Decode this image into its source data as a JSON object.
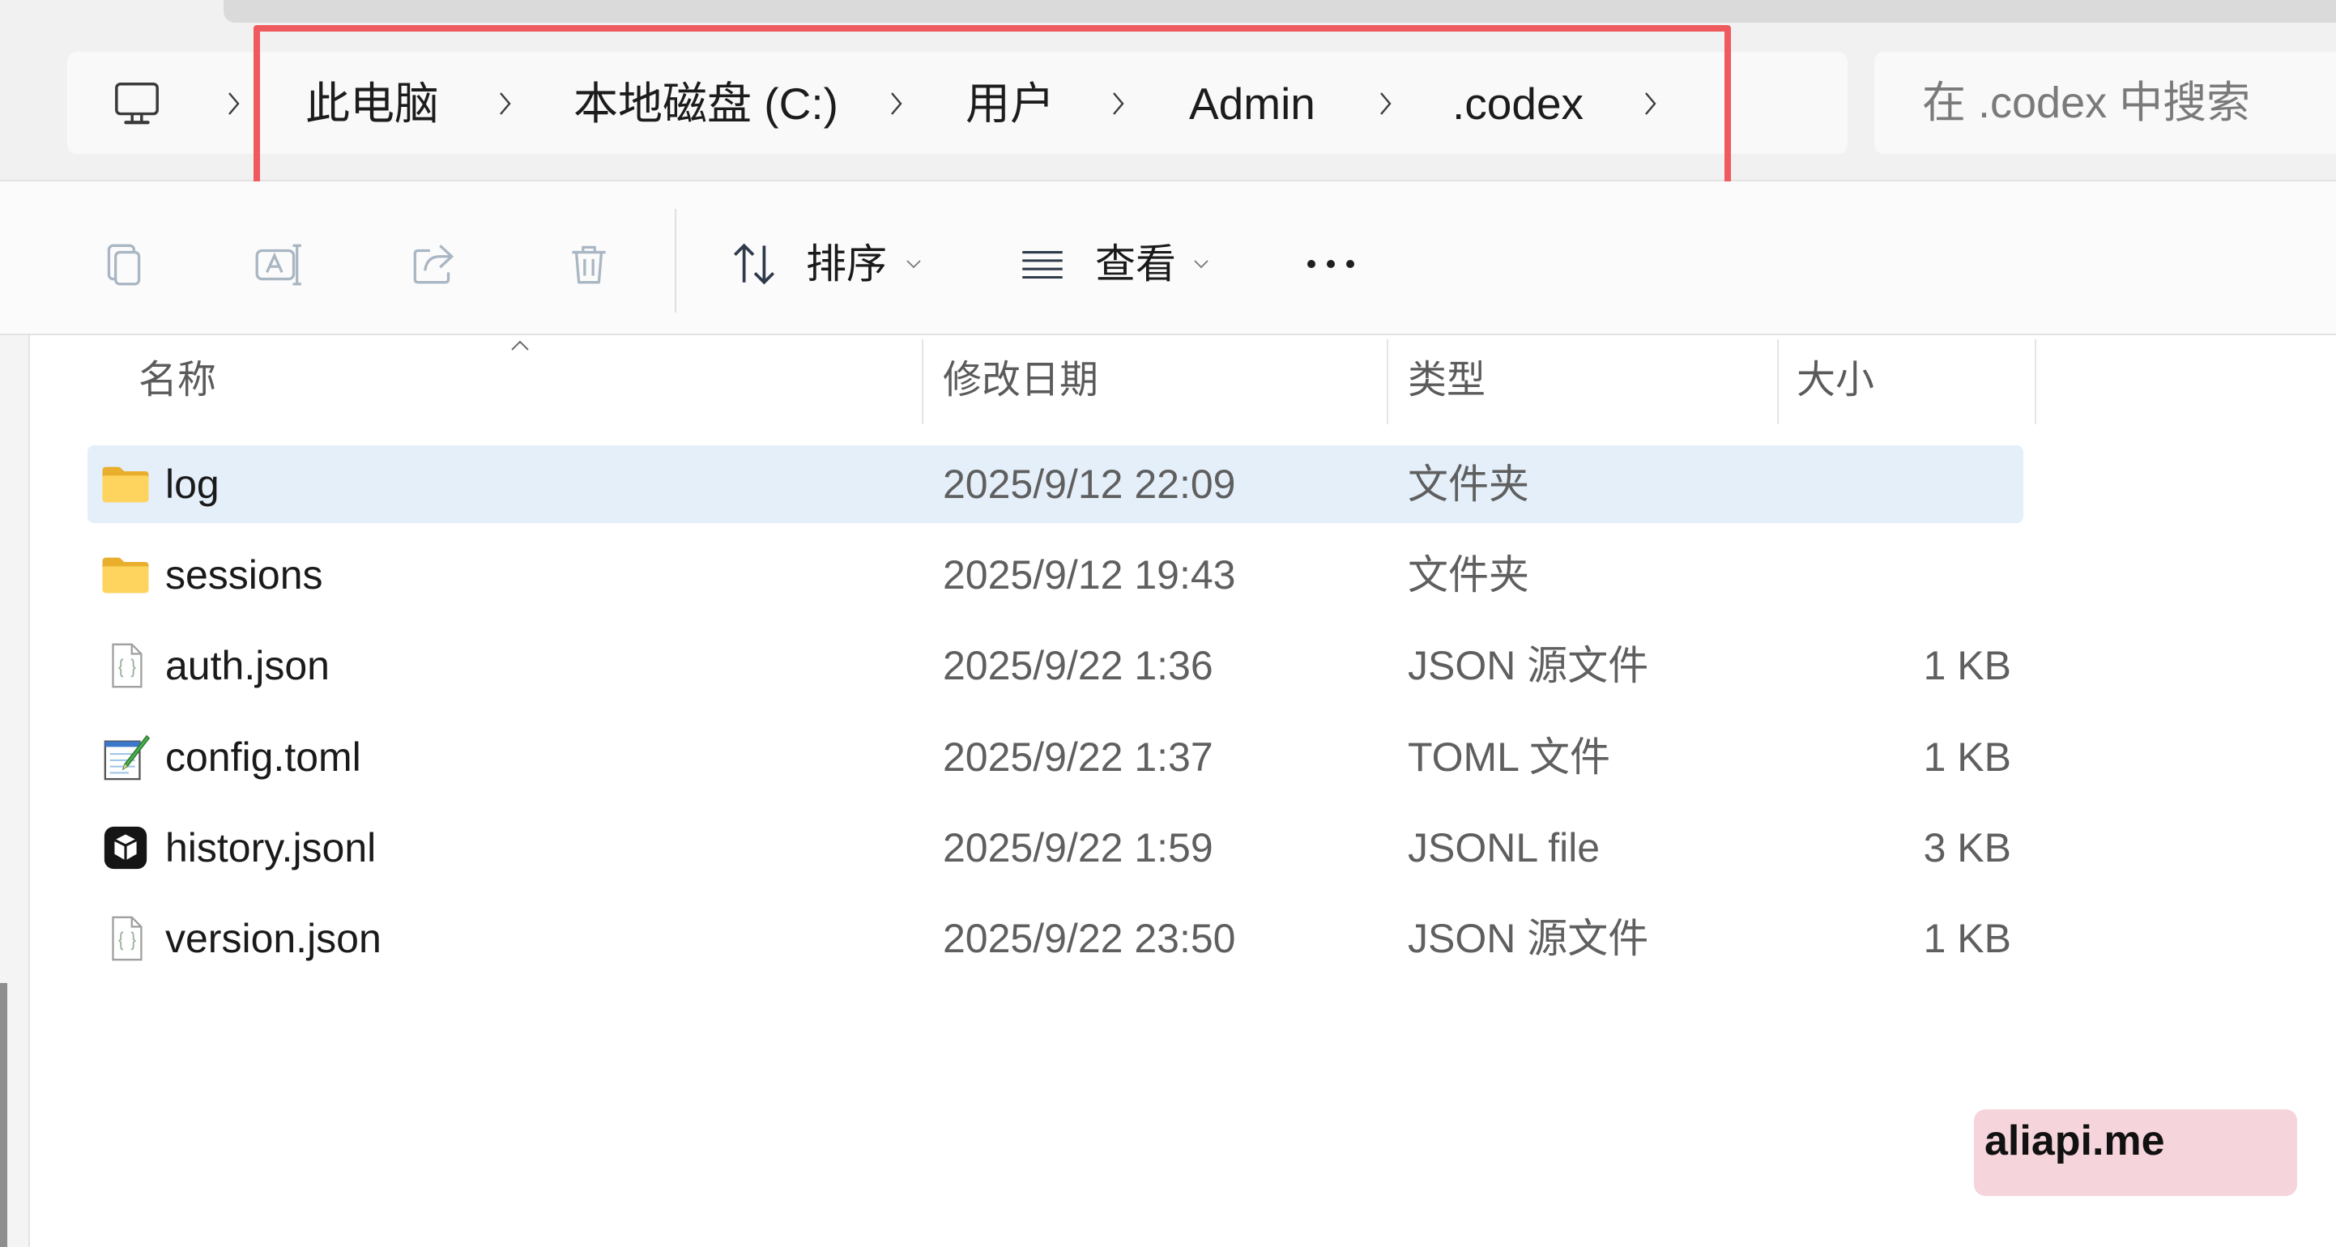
{
  "address_bar": {
    "icon": "computer-icon",
    "breadcrumb": [
      "此电脑",
      "本地磁盘 (C:)",
      "用户",
      "Admin",
      ".codex"
    ]
  },
  "search": {
    "icon": "none",
    "placeholder": "在 .codex 中搜索"
  },
  "toolbar": {
    "icons": [
      "copy-icon",
      "rename-icon",
      "share-icon",
      "delete-icon"
    ],
    "sort_label": "排序",
    "view_label": "查看"
  },
  "columns": {
    "name": "名称",
    "modified": "修改日期",
    "type": "类型",
    "size": "大小"
  },
  "files": [
    {
      "icon": "folder-icon",
      "name": "log",
      "modified": "2025/9/12 22:09",
      "type": "文件夹",
      "highlighted": true
    },
    {
      "icon": "folder-icon",
      "name": "sessions",
      "modified": "2025/9/12 19:43",
      "type": "文件夹"
    },
    {
      "icon": "json-file-icon",
      "name": "auth.json",
      "modified": "2025/9/22 1:36",
      "type": "JSON 源文件",
      "size": "1 KB"
    },
    {
      "icon": "toml-file-icon",
      "name": "config.toml",
      "modified": "2025/9/22 1:37",
      "type": "TOML 文件",
      "size": "1 KB"
    },
    {
      "icon": "jsonl-file-icon",
      "name": "history.jsonl",
      "modified": "2025/9/22 1:59",
      "type": "JSONL file",
      "size": "3 KB"
    },
    {
      "icon": "json-file-icon",
      "name": "version.json",
      "modified": "2025/9/22 23:50",
      "type": "JSON 源文件",
      "size": "1 KB"
    }
  ],
  "watermark": {
    "text": "aliapi.me"
  },
  "colors": {
    "highlight_frame": "#ef5a5f",
    "row_highlight": "#e4effa",
    "watermark_background": "#f5d4db",
    "folder": "#ffd45e"
  }
}
